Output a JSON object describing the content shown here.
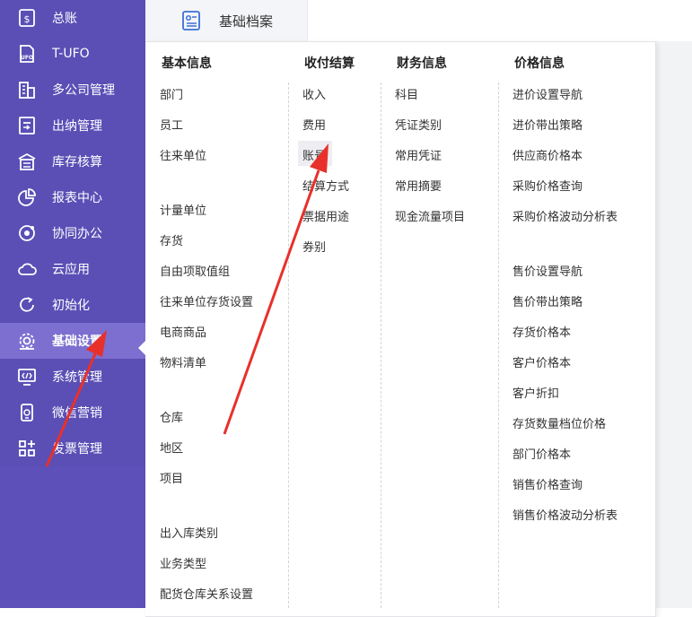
{
  "sidebar": {
    "items": [
      {
        "label": "总账",
        "icon": "ledger-icon"
      },
      {
        "label": "T-UFO",
        "icon": "ufo-report-icon"
      },
      {
        "label": "多公司管理",
        "icon": "multi-company-icon"
      },
      {
        "label": "出纳管理",
        "icon": "cashier-icon"
      },
      {
        "label": "库存核算",
        "icon": "inventory-icon"
      },
      {
        "label": "报表中心",
        "icon": "pie-chart-icon"
      },
      {
        "label": "协同办公",
        "icon": "collaboration-icon"
      },
      {
        "label": "云应用",
        "icon": "cloud-icon"
      },
      {
        "label": "初始化",
        "icon": "refresh-icon"
      },
      {
        "label": "基础设置",
        "icon": "gear-icon"
      },
      {
        "label": "系统管理",
        "icon": "code-monitor-icon"
      },
      {
        "label": "微信营销",
        "icon": "phone-icon"
      },
      {
        "label": "发票管理",
        "icon": "apps-grid-icon"
      }
    ],
    "active_index": 9,
    "colors": {
      "bg": "#5b4fb6",
      "active": "#7c6fd0"
    }
  },
  "top_tab": {
    "label": "基础档案",
    "icon": "archive-card-icon"
  },
  "menu": {
    "basic": {
      "header": "基本信息",
      "items": [
        "部门",
        "员工",
        "往来单位",
        "计量单位",
        "存货",
        "自由项取值组",
        "往来单位存货设置",
        "电商商品",
        "物料清单",
        "仓库",
        "地区",
        "项目",
        "出入库类别",
        "业务类型",
        "配货仓库关系设置"
      ]
    },
    "payment": {
      "header": "收付结算",
      "items": [
        "收入",
        "费用",
        "账号",
        "结算方式",
        "票据用途",
        "券别"
      ]
    },
    "finance": {
      "header": "财务信息",
      "items": [
        "科目",
        "凭证类别",
        "常用凭证",
        "常用摘要",
        "现金流量项目"
      ]
    },
    "price": {
      "header": "价格信息",
      "items": [
        "进价设置导航",
        "进价带出策略",
        "供应商价格本",
        "采购价格查询",
        "采购价格波动分析表",
        "售价设置导航",
        "售价带出策略",
        "存货价格本",
        "客户价格本",
        "客户折扣",
        "存货数量档位价格",
        "部门价格本",
        "销售价格查询",
        "销售价格波动分析表"
      ]
    }
  },
  "annotation_color": "#e8302a"
}
